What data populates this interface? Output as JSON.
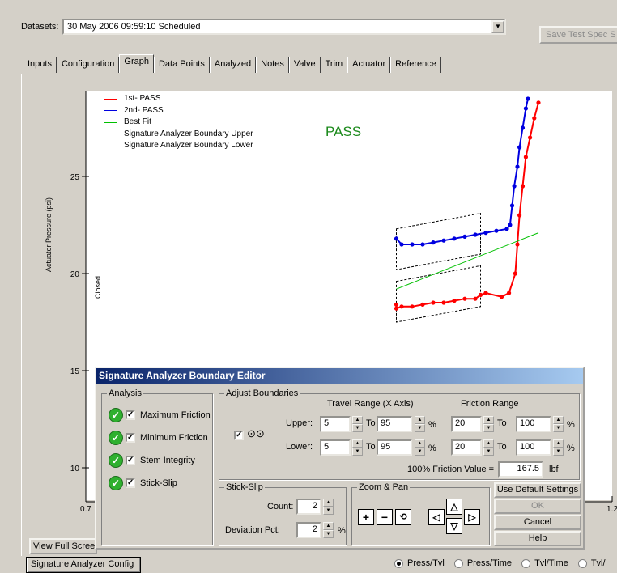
{
  "datasets": {
    "label": "Datasets:",
    "value": "30 May 2006 09:59:10   Scheduled",
    "save_button": "Save Test Spec S"
  },
  "tabs": [
    "Inputs",
    "Configuration",
    "Graph",
    "Data Points",
    "Analyzed",
    "Notes",
    "Valve",
    "Trim",
    "Actuator",
    "Reference"
  ],
  "chart": {
    "ylabel": "Actuator Pressure (psi)",
    "closed_label": "Closed",
    "status": "PASS",
    "legend": [
      "1st- PASS",
      "2nd- PASS",
      "Best Fit",
      "Signature Analyzer Boundary Upper",
      "Signature Analyzer Boundary Lower"
    ],
    "colors": {
      "first": "#ff0000",
      "second": "#0000e0",
      "bestfit": "#00c000",
      "boundary": "#000000"
    }
  },
  "chart_data": {
    "type": "line",
    "ylabel": "Actuator Pressure (psi)",
    "y_ticks": [
      10,
      15,
      20,
      25
    ],
    "x_ticks": [
      "0.7",
      "1.2"
    ],
    "xlim": [
      0.7,
      1.2
    ],
    "ylim": [
      9,
      29
    ],
    "series": [
      {
        "name": "1st- PASS",
        "x": [
          0.995,
          0.995,
          1.0,
          1.01,
          1.02,
          1.03,
          1.04,
          1.05,
          1.06,
          1.07,
          1.075,
          1.08,
          1.095,
          1.102,
          1.108,
          1.11,
          1.112,
          1.115,
          1.118,
          1.122,
          1.126,
          1.13
        ],
        "y": [
          18.4,
          18.2,
          18.3,
          18.3,
          18.4,
          18.5,
          18.5,
          18.6,
          18.7,
          18.7,
          18.9,
          19.0,
          18.8,
          19.0,
          20.0,
          21.5,
          23.0,
          24.5,
          26.0,
          27.0,
          28.0,
          28.8
        ]
      },
      {
        "name": "2nd- PASS",
        "x": [
          0.995,
          1.0,
          1.01,
          1.02,
          1.03,
          1.04,
          1.05,
          1.06,
          1.07,
          1.08,
          1.09,
          1.1,
          1.103,
          1.105,
          1.107,
          1.11,
          1.112,
          1.115,
          1.118,
          1.12
        ],
        "y": [
          21.8,
          21.5,
          21.5,
          21.5,
          21.6,
          21.7,
          21.8,
          21.9,
          22.0,
          22.1,
          22.2,
          22.3,
          22.5,
          23.5,
          24.5,
          25.5,
          26.5,
          27.5,
          28.5,
          29.0
        ]
      },
      {
        "name": "Best Fit",
        "x": [
          0.995,
          1.13
        ],
        "y": [
          19.2,
          22.1
        ]
      }
    ]
  },
  "buttons": {
    "full_screen": "View Full Screen",
    "sig_config": "Signature Analyzer Config"
  },
  "radios": [
    {
      "label": "Press/Tvl",
      "checked": true
    },
    {
      "label": "Press/Time",
      "checked": false
    },
    {
      "label": "Tvl/Time",
      "checked": false
    },
    {
      "label": "Tvl/",
      "checked": false
    }
  ],
  "dialog": {
    "title": "Signature Analyzer Boundary Editor",
    "analysis": {
      "label": "Analysis",
      "items": [
        "Maximum Friction",
        "Minimum Friction",
        "Stem Integrity",
        "Stick-Slip"
      ]
    },
    "adjust": {
      "label": "Adjust Boundaries",
      "travel_header": "Travel Range (X Axis)",
      "friction_header": "Friction Range",
      "upper_label": "Upper:",
      "lower_label": "Lower:",
      "to": "To",
      "pct": "%",
      "upper": {
        "t_from": "5",
        "t_to": "95",
        "f_from": "20",
        "f_to": "100"
      },
      "lower": {
        "t_from": "5",
        "t_to": "95",
        "f_from": "20",
        "f_to": "100"
      },
      "friction_value_label": "100% Friction Value =",
      "friction_value": "167.5",
      "unit": "lbf"
    },
    "stick": {
      "label": "Stick-Slip",
      "count_label": "Count:",
      "count": "2",
      "dev_label": "Deviation Pct:",
      "dev": "2",
      "pct": "%"
    },
    "zoom": {
      "label": "Zoom & Pan"
    },
    "buttons": {
      "defaults": "Use Default Settings",
      "ok": "OK",
      "cancel": "Cancel",
      "help": "Help"
    }
  }
}
